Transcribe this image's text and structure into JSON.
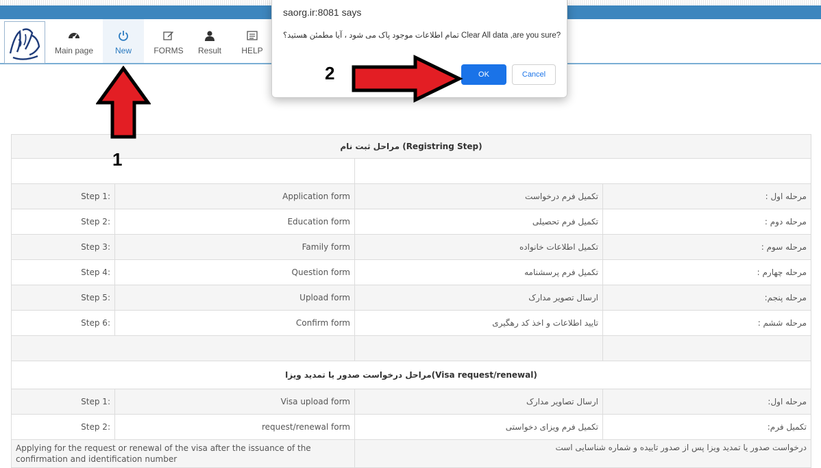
{
  "nav": {
    "items": [
      {
        "label": "Main page",
        "icon": "dashboard-icon"
      },
      {
        "label": "New",
        "icon": "power-icon"
      },
      {
        "label": "FORMS",
        "icon": "edit-icon"
      },
      {
        "label": "Result",
        "icon": "user-icon"
      },
      {
        "label": "HELP",
        "icon": "list-icon"
      }
    ],
    "active": "New"
  },
  "dialog": {
    "title": "saorg.ir:8081 says",
    "message": "تمام اطلاعات موجود پاک می شود ، آیا مطمئن هستید؟ Clear All data ,are you sure?",
    "ok_label": "OK",
    "cancel_label": "Cancel",
    "ok_color": "#1a73e8"
  },
  "annotations": {
    "arrow1_label": "1",
    "arrow2_label": "2",
    "arrow_color": "#e31e24"
  },
  "registering": {
    "header": "مراحل ثبت نام  (Registring Step)",
    "rows": [
      {
        "step": "Step 1:",
        "form": "Application form",
        "fa_desc": "تکمیل فرم درخواست",
        "fa_step": "مرحله اول :"
      },
      {
        "step": "Step 2:",
        "form": "Education form",
        "fa_desc": "تکمیل فرم تحصیلی",
        "fa_step": "مرحله دوم :"
      },
      {
        "step": "Step 3:",
        "form": "Family form",
        "fa_desc": "تکمیل اطلاعات خانواده",
        "fa_step": "مرحله سوم :"
      },
      {
        "step": "Step 4:",
        "form": "Question form",
        "fa_desc": "تکمیل فرم پرسشنامه",
        "fa_step": "مرحله چهارم :"
      },
      {
        "step": "Step 5:",
        "form": "Upload form",
        "fa_desc": "ارسال تصویر مدارک",
        "fa_step": "مرحله پنجم:"
      },
      {
        "step": "Step 6:",
        "form": "Confirm form",
        "fa_desc": "تایید اطلاعات و اخذ کد رهگیری",
        "fa_step": "مرحله ششم :"
      }
    ]
  },
  "visa": {
    "header": "مراحل درخواست صدور یا تمدید ویزا(Visa request/renewal)",
    "rows": [
      {
        "step": "Step 1:",
        "form": "Visa upload form",
        "fa_desc": "ارسال تصاویر مدارک",
        "fa_step": "مرحله اول:"
      },
      {
        "step": "Step 2:",
        "form": "request/renewal form",
        "fa_desc": "تکمیل فرم ویزای دخواستی",
        "fa_step": "تکمیل فرم:"
      }
    ],
    "note_en": "Applying for the request or renewal of the visa after the issuance of the confirmation and identification number",
    "note_fa": "درخواست صدور یا تمدید ویزا پس از صدور تاییده و شماره شناسایی است"
  }
}
